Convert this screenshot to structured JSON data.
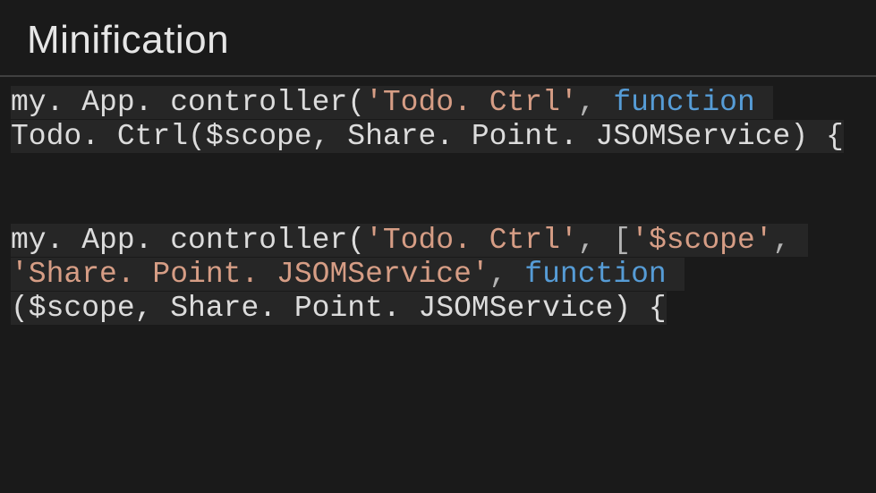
{
  "title": "Minification",
  "code1": {
    "t1": "my. App. controller(",
    "t2": "'Todo. Ctrl'",
    "t3": ", ",
    "t4": "function",
    "t5": " ",
    "t6": "Todo. Ctrl($scope, Share. Point. JSOMService) {"
  },
  "code2": {
    "t1": "my. App. controller(",
    "t2": "'Todo. Ctrl'",
    "t3": ", [",
    "t4": "'$scope'",
    "t5": ", ",
    "t6": "'Share. Point. JSOMService'",
    "t7": ", ",
    "t8": "function",
    "t9": " ",
    "t10": "($scope, Share. Point. JSOMService) {"
  }
}
